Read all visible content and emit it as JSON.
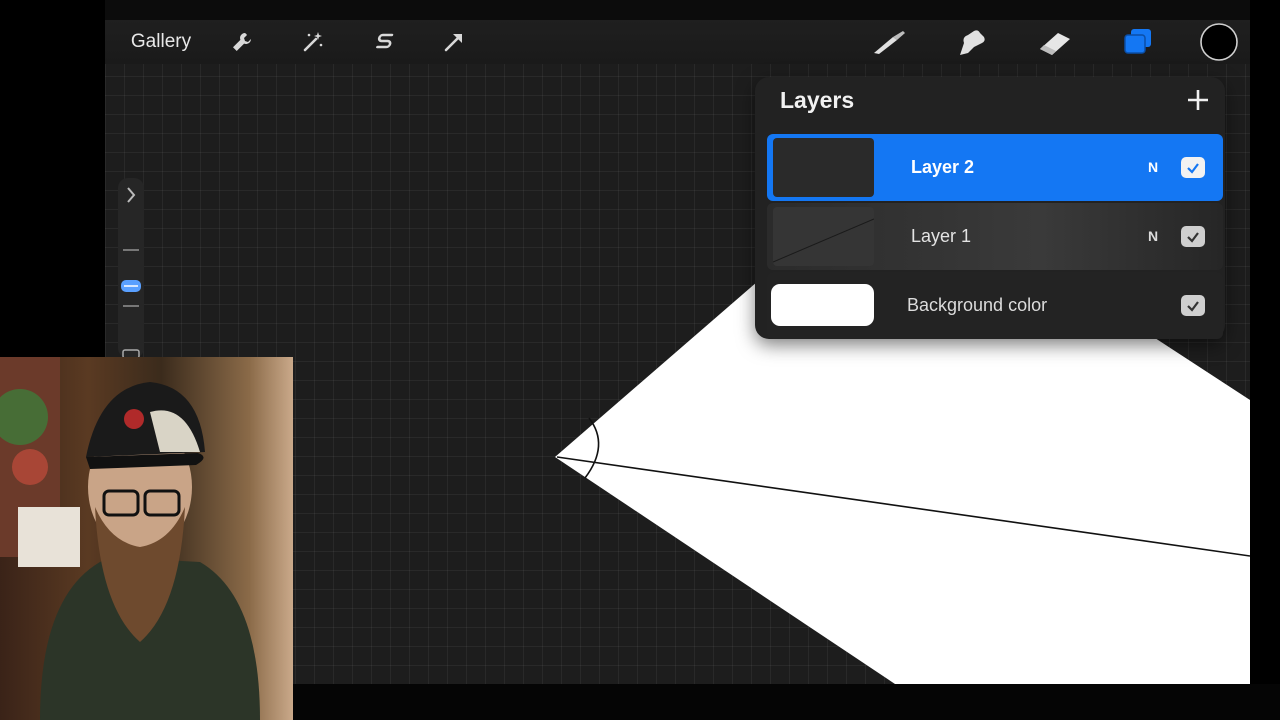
{
  "toolbar": {
    "gallery_label": "Gallery",
    "left_tools": [
      "wrench-icon",
      "magic-wand-icon",
      "selection-s-icon",
      "transform-arrow-icon"
    ],
    "right_tools": [
      "brush-icon",
      "smudge-icon",
      "eraser-icon",
      "layers-icon",
      "color-swatch"
    ],
    "accent_color": "#1477f3"
  },
  "layers": {
    "title": "Layers",
    "items": [
      {
        "name": "Layer 2",
        "mode": "N",
        "visible": true,
        "selected": true
      },
      {
        "name": "Layer 1",
        "mode": "N",
        "visible": true,
        "selected": false
      },
      {
        "name": "Background color",
        "visible": true,
        "selected": false
      }
    ]
  },
  "colors": {
    "canvas_bg": "#1d1d1d",
    "panel_bg": "#222222",
    "selected_row": "#1477f3"
  }
}
